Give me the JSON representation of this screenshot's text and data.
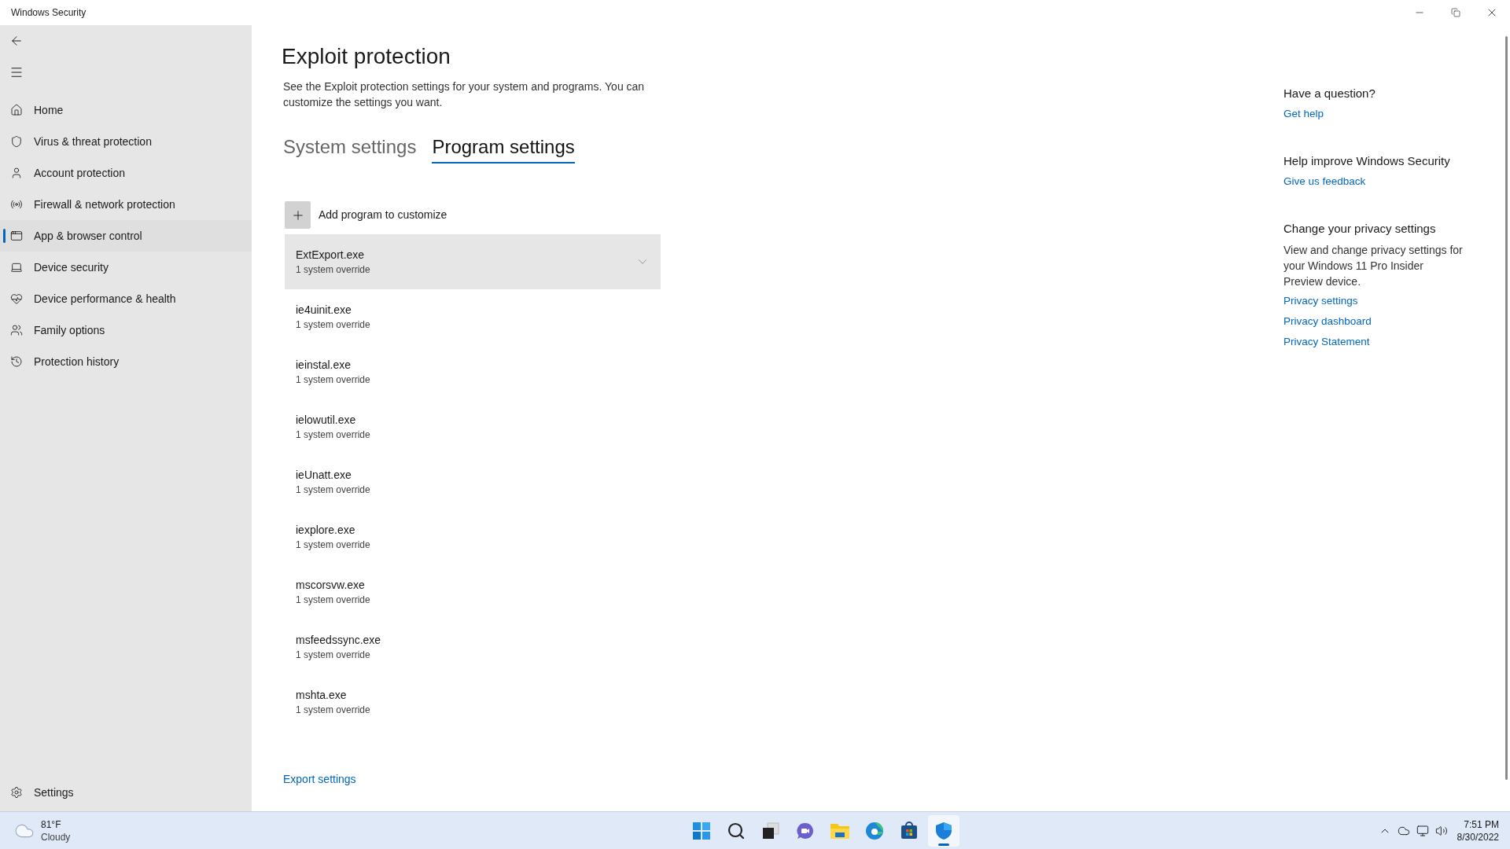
{
  "window": {
    "title": "Windows Security"
  },
  "sidebar": {
    "items": [
      {
        "kind": "home",
        "label": "Home",
        "selected": false
      },
      {
        "kind": "virus",
        "label": "Virus & threat protection",
        "selected": false
      },
      {
        "kind": "account",
        "label": "Account protection",
        "selected": false
      },
      {
        "kind": "firewall",
        "label": "Firewall & network protection",
        "selected": false
      },
      {
        "kind": "app",
        "label": "App & browser control",
        "selected": true
      },
      {
        "kind": "device",
        "label": "Device security",
        "selected": false
      },
      {
        "kind": "health",
        "label": "Device performance & health",
        "selected": false
      },
      {
        "kind": "family",
        "label": "Family options",
        "selected": false
      },
      {
        "kind": "history",
        "label": "Protection history",
        "selected": false
      }
    ],
    "settings": "Settings"
  },
  "page": {
    "title": "Exploit protection",
    "description": "See the Exploit protection settings for your system and programs.  You can customize the settings you want.",
    "tabs": [
      {
        "label": "System settings",
        "selected": false
      },
      {
        "label": "Program settings",
        "selected": true
      }
    ],
    "add_button": "Add program to customize",
    "programs": [
      {
        "name": "ExtExport.exe",
        "detail": "1 system override",
        "selected": true
      },
      {
        "name": "ie4uinit.exe",
        "detail": "1 system override",
        "selected": false
      },
      {
        "name": "ieinstal.exe",
        "detail": "1 system override",
        "selected": false
      },
      {
        "name": "ielowutil.exe",
        "detail": "1 system override",
        "selected": false
      },
      {
        "name": "ieUnatt.exe",
        "detail": "1 system override",
        "selected": false
      },
      {
        "name": "iexplore.exe",
        "detail": "1 system override",
        "selected": false
      },
      {
        "name": "mscorsvw.exe",
        "detail": "1 system override",
        "selected": false
      },
      {
        "name": "msfeedssync.exe",
        "detail": "1 system override",
        "selected": false
      },
      {
        "name": "mshta.exe",
        "detail": "1 system override",
        "selected": false
      }
    ],
    "export_link": "Export settings"
  },
  "aside": [
    {
      "heading": "Have a question?",
      "links": [
        "Get help"
      ]
    },
    {
      "heading": "Help improve Windows Security",
      "links": [
        "Give us feedback"
      ]
    },
    {
      "heading": "Change your privacy settings",
      "text": "View and change privacy settings for your Windows 11 Pro Insider Preview device.",
      "links": [
        "Privacy settings",
        "Privacy dashboard",
        "Privacy Statement"
      ]
    }
  ],
  "taskbar": {
    "weather": {
      "temp": "81°F",
      "condition": "Cloudy"
    },
    "apps": [
      {
        "kind": "start",
        "selected": false
      },
      {
        "kind": "search",
        "selected": false
      },
      {
        "kind": "taskview",
        "selected": false
      },
      {
        "kind": "chat",
        "selected": false
      },
      {
        "kind": "explorer",
        "selected": false
      },
      {
        "kind": "edge",
        "selected": false
      },
      {
        "kind": "store",
        "selected": false
      },
      {
        "kind": "security",
        "selected": true
      }
    ],
    "time": "7:51 PM",
    "date": "8/30/2022"
  }
}
